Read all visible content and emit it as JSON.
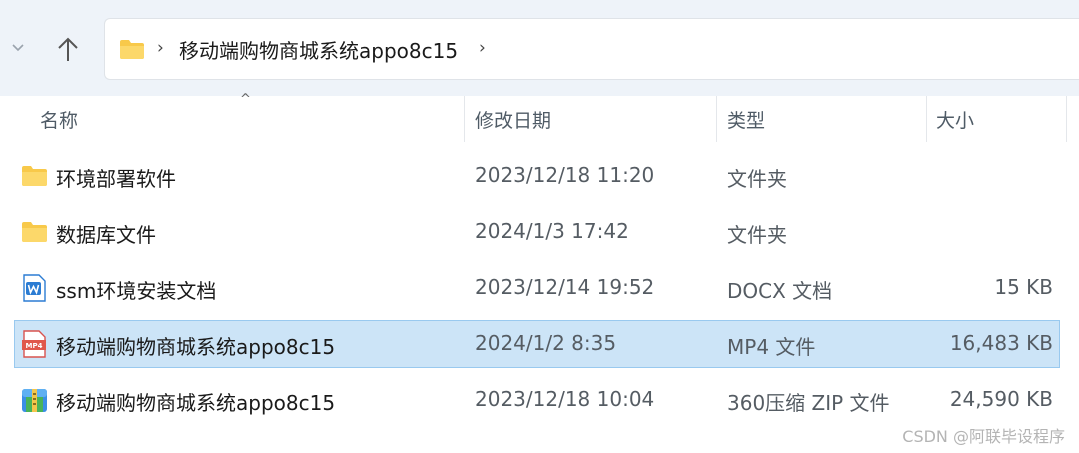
{
  "address_bar": {
    "path": "移动端购物商城系统appo8c15",
    "separator": "›"
  },
  "nav": {
    "recent_icon": "chevron-down-icon",
    "up_icon": "arrow-up-icon"
  },
  "columns": {
    "name": "名称",
    "date": "修改日期",
    "type": "类型",
    "size": "大小"
  },
  "sort_indicator": "^",
  "files": [
    {
      "name": "环境部署软件",
      "date": "2023/12/18 11:20",
      "type": "文件夹",
      "size": "",
      "icon": "folder-icon",
      "selected": false
    },
    {
      "name": "数据库文件",
      "date": "2024/1/3 17:42",
      "type": "文件夹",
      "size": "",
      "icon": "folder-icon",
      "selected": false
    },
    {
      "name": "ssm环境安装文档",
      "date": "2023/12/14 19:52",
      "type": "DOCX 文档",
      "size": "15 KB",
      "icon": "docx-icon",
      "selected": false
    },
    {
      "name": "移动端购物商城系统appo8c15",
      "date": "2024/1/2 8:35",
      "type": "MP4 文件",
      "size": "16,483 KB",
      "icon": "mp4-icon",
      "icon_label": "MP4",
      "selected": true
    },
    {
      "name": "移动端购物商城系统appo8c15",
      "date": "2023/12/18 10:04",
      "type": "360压缩 ZIP 文件",
      "size": "24,590 KB",
      "icon": "zip-icon",
      "selected": false
    }
  ],
  "watermark": "CSDN @阿联毕设程序",
  "colors": {
    "toolbar_bg": "#eef3f9",
    "selection_bg": "#cce4f7",
    "selection_border": "#99c9ef",
    "folder_yellow": "#f8c94a",
    "docx_blue": "#2b7cd3",
    "mp4_red": "#d9534f"
  }
}
